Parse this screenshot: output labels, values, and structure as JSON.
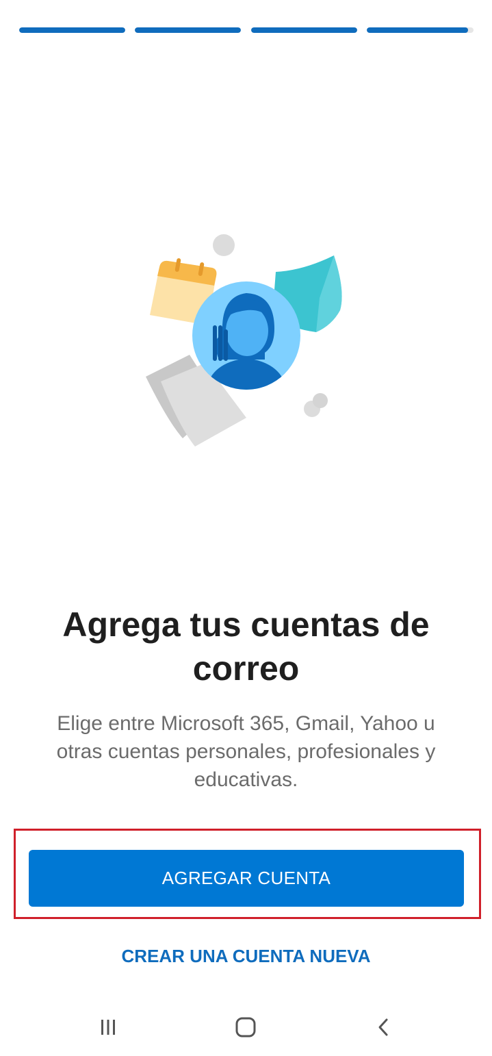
{
  "progress": {
    "segments": [
      {
        "fill": 1.0
      },
      {
        "fill": 1.0
      },
      {
        "fill": 1.0
      },
      {
        "fill": 0.95
      }
    ],
    "color": "#0f6cbd"
  },
  "illustration": {
    "icons": [
      "calendar-icon",
      "shield-icon",
      "avatar-icon",
      "documents-icon"
    ]
  },
  "onboarding": {
    "title": "Agrega tus cuentas de correo",
    "subtitle": "Elige entre Microsoft 365, Gmail, Yahoo u otras cuentas personales, profesionales y educativas."
  },
  "actions": {
    "add_account_label": "AGREGAR CUENTA",
    "create_account_label": "CREAR UNA CUENTA NUEVA",
    "accent_color": "#0078d4",
    "highlight_color": "#d0202a"
  },
  "system_nav": {
    "icons": [
      "recent-apps-icon",
      "home-icon",
      "back-icon"
    ]
  }
}
